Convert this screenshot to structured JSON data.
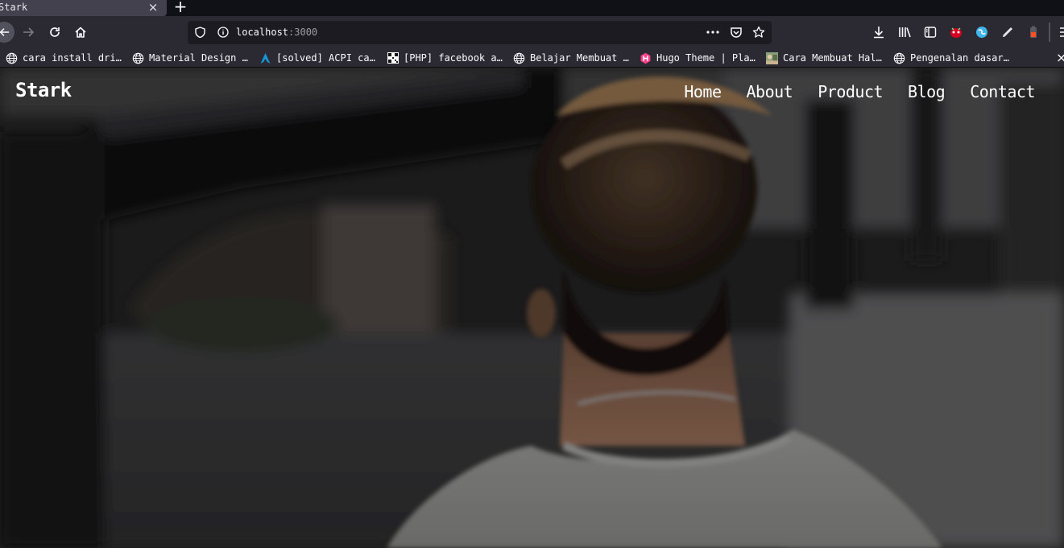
{
  "browser": {
    "tab": {
      "title": "Stark",
      "close_glyph": "×"
    },
    "new_tab_glyph": "+",
    "url": {
      "host": "localhost",
      "port": ":3000"
    },
    "bookmarks": [
      {
        "label": "cara install dri…",
        "icon": "globe-icon"
      },
      {
        "label": "Material Design …",
        "icon": "globe-icon"
      },
      {
        "label": "[solved] ACPI ca…",
        "icon": "arch-linux-icon"
      },
      {
        "label": "[PHP] facebook a…",
        "icon": "qr-favicon-icon"
      },
      {
        "label": "Belajar Membuat …",
        "icon": "globe-icon"
      },
      {
        "label": "Hugo Theme | Pla…",
        "icon": "hugo-icon"
      },
      {
        "label": "Cara Membuat Hal…",
        "icon": "photo-favicon-icon"
      },
      {
        "label": "Pengenalan dasar…",
        "icon": "globe-icon"
      }
    ],
    "more_bookmarks_glyph": "×"
  },
  "site": {
    "brand": "Stark",
    "nav": [
      "Home",
      "About",
      "Product",
      "Blog",
      "Contact"
    ]
  },
  "colors": {
    "toolbar": "#2b2a33",
    "urlbar": "#1c1b22",
    "tabstrip": "#0f1117",
    "hugo": "#ff4088",
    "arch": "#1793d1"
  }
}
